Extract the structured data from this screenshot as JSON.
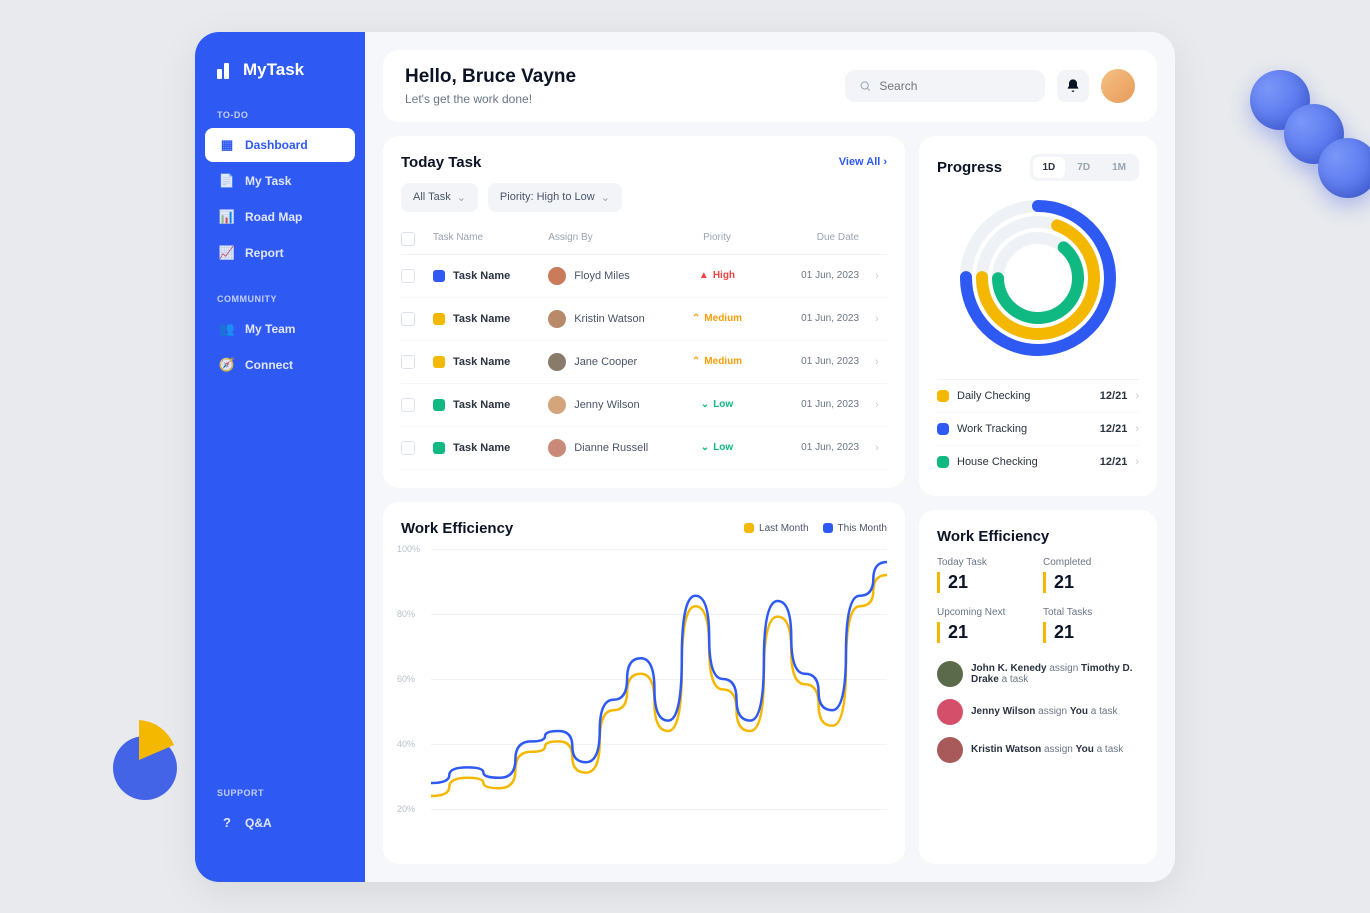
{
  "brand": "MyTask",
  "sidebar": {
    "sections": [
      {
        "heading": "TO-DO",
        "items": [
          {
            "label": "Dashboard",
            "icon": "grid",
            "active": true
          },
          {
            "label": "My Task",
            "icon": "doc"
          },
          {
            "label": "Road Map",
            "icon": "chart"
          },
          {
            "label": "Report",
            "icon": "calendar"
          }
        ]
      },
      {
        "heading": "COMMUNITY",
        "items": [
          {
            "label": "My Team",
            "icon": "team"
          },
          {
            "label": "Connect",
            "icon": "compass"
          }
        ]
      },
      {
        "heading": "SUPPORT",
        "items": [
          {
            "label": "Q&A",
            "icon": "help"
          }
        ]
      }
    ]
  },
  "header": {
    "greeting": "Hello, Bruce Vayne",
    "subtitle": "Let's get the work done!",
    "search_placeholder": "Search"
  },
  "today_task": {
    "title": "Today Task",
    "view_all": "View All",
    "filters": {
      "all": "All Task",
      "sort": "Piority: High to Low"
    },
    "columns": [
      "Task Name",
      "Assign By",
      "Piority",
      "Due Date"
    ],
    "rows": [
      {
        "color": "#2e59f2",
        "name": "Task Name",
        "assignee": "Floyd Miles",
        "avatar": "#c97b5a",
        "priority": "High",
        "priority_class": "prio-high",
        "due": "01 Jun, 2023"
      },
      {
        "color": "#f5b800",
        "name": "Task Name",
        "assignee": "Kristin Watson",
        "avatar": "#b88a6a",
        "priority": "Medium",
        "priority_class": "prio-med",
        "due": "01 Jun, 2023"
      },
      {
        "color": "#f5b800",
        "name": "Task Name",
        "assignee": "Jane Cooper",
        "avatar": "#8a7a6a",
        "priority": "Medium",
        "priority_class": "prio-med",
        "due": "01 Jun, 2023"
      },
      {
        "color": "#10b981",
        "name": "Task Name",
        "assignee": "Jenny Wilson",
        "avatar": "#d4a57a",
        "priority": "Low",
        "priority_class": "prio-low",
        "due": "01 Jun, 2023"
      },
      {
        "color": "#10b981",
        "name": "Task Name",
        "assignee": "Dianne Russell",
        "avatar": "#c98a7a",
        "priority": "Low",
        "priority_class": "prio-low",
        "due": "01 Jun, 2023"
      }
    ]
  },
  "efficiency": {
    "title": "Work Efficiency",
    "legend": {
      "last": "Last Month",
      "this": "This Month"
    },
    "y_ticks": [
      "100%",
      "80%",
      "60%",
      "40%",
      "20%"
    ]
  },
  "progress": {
    "title": "Progress",
    "tabs": [
      "1D",
      "7D",
      "1M"
    ],
    "items": [
      {
        "label": "Daily Checking",
        "val": "12/21",
        "color": "#f5b800"
      },
      {
        "label": "Work Tracking",
        "val": "12/21",
        "color": "#2e59f2"
      },
      {
        "label": "House Checking",
        "val": "12/21",
        "color": "#10b981"
      }
    ]
  },
  "work_eff": {
    "title": "Work Efficiency",
    "stats": [
      {
        "label": "Today Task",
        "val": "21"
      },
      {
        "label": "Completed",
        "val": "21"
      },
      {
        "label": "Upcoming Next",
        "val": "21"
      },
      {
        "label": "Total Tasks",
        "val": "21"
      }
    ],
    "activity": [
      {
        "who": "John K. Kenedy",
        "mid": " assign ",
        "target": "Timothy D. Drake",
        "suffix": " a task",
        "color": "#5a6a4a"
      },
      {
        "who": "Jenny Wilson",
        "mid": " assign ",
        "target": "You",
        "suffix": " a task",
        "color": "#d4506a"
      },
      {
        "who": "Kristin Watson",
        "mid": " assign ",
        "target": "You",
        "suffix": " a task",
        "color": "#a85a5a"
      }
    ]
  },
  "chart_data": {
    "type": "line",
    "title": "Work Efficiency",
    "ylabel": "%",
    "ylim": [
      0,
      100
    ],
    "y_ticks": [
      20,
      40,
      60,
      80,
      100
    ],
    "x_range": [
      0,
      100
    ],
    "series": [
      {
        "name": "Last Month",
        "color": "#f5b800",
        "values": [
          {
            "x": 0,
            "y": 5
          },
          {
            "x": 8,
            "y": 12
          },
          {
            "x": 15,
            "y": 8
          },
          {
            "x": 22,
            "y": 22
          },
          {
            "x": 28,
            "y": 26
          },
          {
            "x": 34,
            "y": 14
          },
          {
            "x": 40,
            "y": 38
          },
          {
            "x": 46,
            "y": 52
          },
          {
            "x": 52,
            "y": 30
          },
          {
            "x": 58,
            "y": 78
          },
          {
            "x": 64,
            "y": 46
          },
          {
            "x": 70,
            "y": 30
          },
          {
            "x": 76,
            "y": 74
          },
          {
            "x": 82,
            "y": 48
          },
          {
            "x": 88,
            "y": 32
          },
          {
            "x": 94,
            "y": 78
          },
          {
            "x": 100,
            "y": 90
          }
        ]
      },
      {
        "name": "This Month",
        "color": "#2e59f2",
        "values": [
          {
            "x": 0,
            "y": 10
          },
          {
            "x": 8,
            "y": 16
          },
          {
            "x": 15,
            "y": 12
          },
          {
            "x": 22,
            "y": 26
          },
          {
            "x": 28,
            "y": 30
          },
          {
            "x": 34,
            "y": 18
          },
          {
            "x": 40,
            "y": 42
          },
          {
            "x": 46,
            "y": 58
          },
          {
            "x": 52,
            "y": 34
          },
          {
            "x": 58,
            "y": 82
          },
          {
            "x": 64,
            "y": 50
          },
          {
            "x": 70,
            "y": 34
          },
          {
            "x": 76,
            "y": 80
          },
          {
            "x": 82,
            "y": 52
          },
          {
            "x": 88,
            "y": 38
          },
          {
            "x": 94,
            "y": 82
          },
          {
            "x": 100,
            "y": 95
          }
        ]
      }
    ]
  }
}
